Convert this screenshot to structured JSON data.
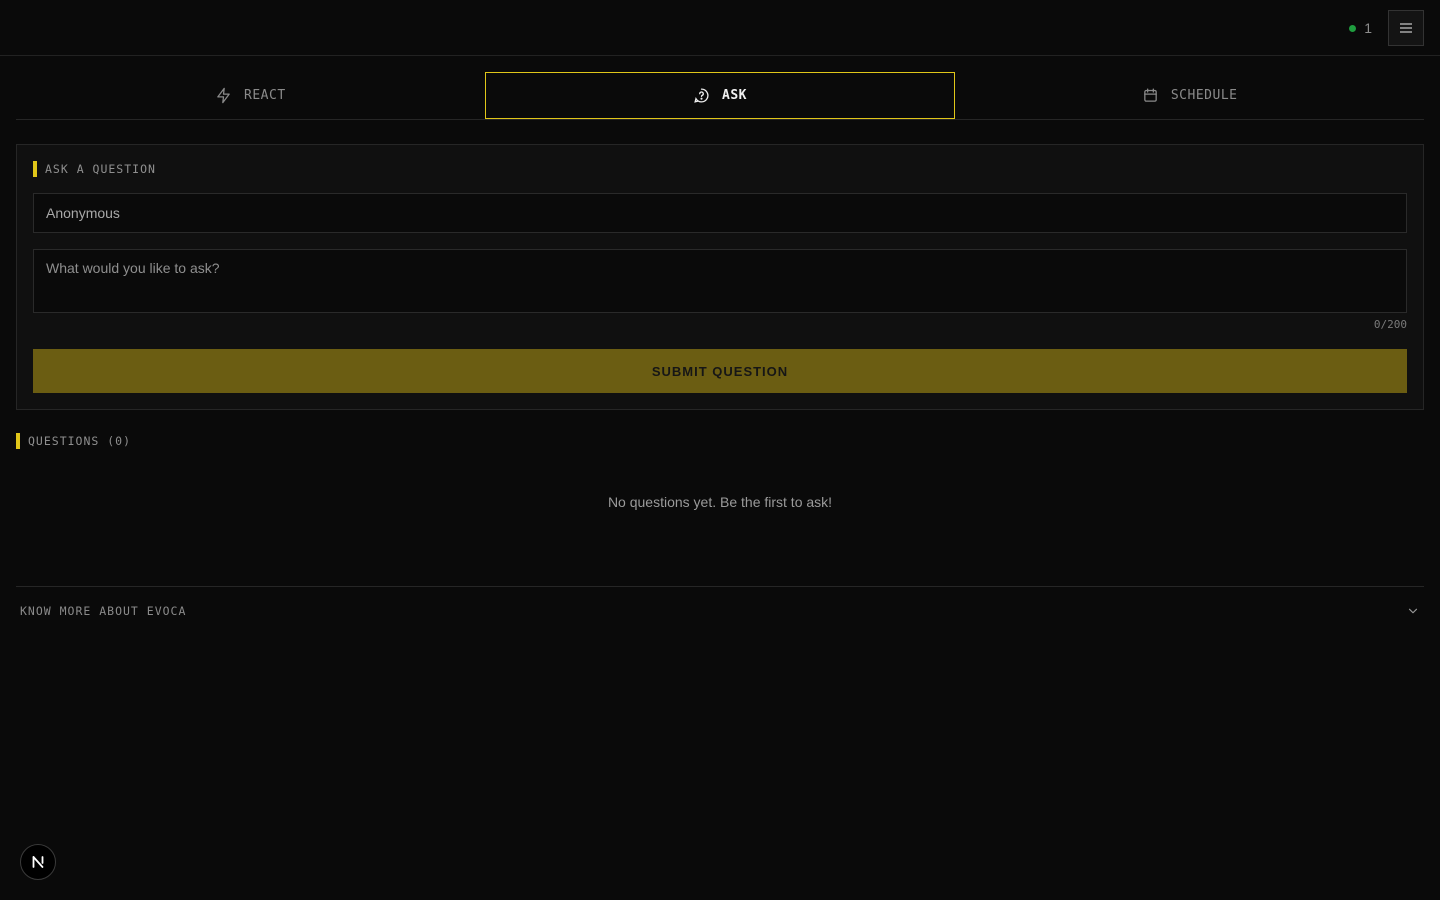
{
  "header": {
    "presence_count": "1",
    "colors": {
      "presence_dot": "#1f9d3f",
      "accent": "#e0c619"
    }
  },
  "tabs": [
    {
      "label": "REACT",
      "icon": "lightning-icon",
      "active": false
    },
    {
      "label": "ASK",
      "icon": "question-circle-icon",
      "active": true
    },
    {
      "label": "SCHEDULE",
      "icon": "calendar-icon",
      "active": false
    }
  ],
  "ask_form": {
    "section_label": "ASK A QUESTION",
    "name_placeholder": "Anonymous",
    "question_placeholder": "What would you like to ask?",
    "char_counter": "0/200",
    "submit_label": "SUBMIT QUESTION"
  },
  "questions": {
    "section_label": "QUESTIONS (0)",
    "empty_text": "No questions yet. Be the first to ask!"
  },
  "accordion": {
    "label": "KNOW MORE ABOUT EVOCA"
  },
  "badge": {
    "letter": "N"
  }
}
